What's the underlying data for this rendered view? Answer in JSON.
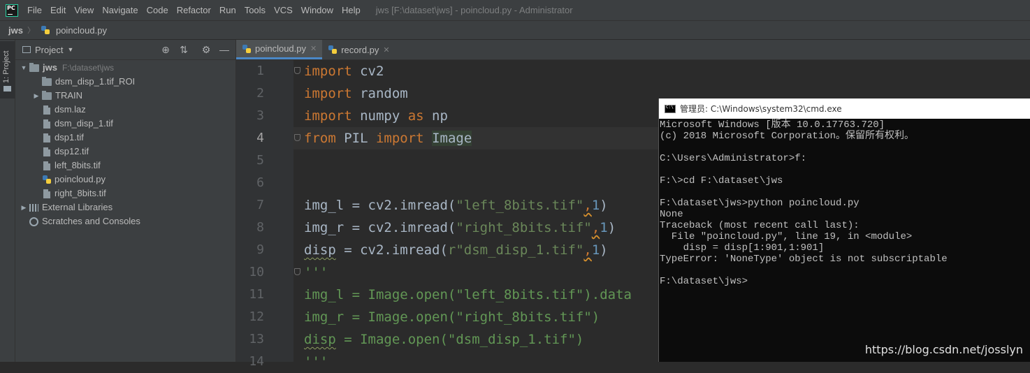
{
  "app": {
    "logo_text": "PC",
    "window_title": "jws [F:\\dataset\\jws] - poincloud.py - Administrator"
  },
  "menu": [
    "File",
    "Edit",
    "View",
    "Navigate",
    "Code",
    "Refactor",
    "Run",
    "Tools",
    "VCS",
    "Window",
    "Help"
  ],
  "breadcrumb": {
    "root": "jws",
    "file": "poincloud.py"
  },
  "toolstrip": {
    "project_tab": "1: Project"
  },
  "project_panel": {
    "title": "Project",
    "tree": [
      {
        "label": "jws",
        "hint": "F:\\dataset\\jws",
        "kind": "folder",
        "expanded": true,
        "depth": 0,
        "bold": true
      },
      {
        "label": "dsm_disp_1.tif_ROI",
        "kind": "folder",
        "depth": 1,
        "expandable": false
      },
      {
        "label": "TRAIN",
        "kind": "folder",
        "depth": 1,
        "expandable": true
      },
      {
        "label": "dsm.laz",
        "kind": "file",
        "depth": 1
      },
      {
        "label": "dsm_disp_1.tif",
        "kind": "file",
        "depth": 1
      },
      {
        "label": "dsp1.tif",
        "kind": "file",
        "depth": 1
      },
      {
        "label": "dsp12.tif",
        "kind": "file",
        "depth": 1
      },
      {
        "label": "left_8bits.tif",
        "kind": "file",
        "depth": 1
      },
      {
        "label": "poincloud.py",
        "kind": "py",
        "depth": 1
      },
      {
        "label": "right_8bits.tif",
        "kind": "file",
        "depth": 1
      },
      {
        "label": "External Libraries",
        "kind": "lib",
        "depth": 0,
        "expandable": true
      },
      {
        "label": "Scratches and Consoles",
        "kind": "scratch",
        "depth": 0
      }
    ]
  },
  "editor": {
    "tabs": [
      {
        "label": "poincloud.py",
        "active": true
      },
      {
        "label": "record.py",
        "active": false
      }
    ],
    "current_line": 4,
    "lines": [
      {
        "n": "1",
        "tokens": [
          [
            "kw",
            "import"
          ],
          [
            "",
            " cv2"
          ]
        ]
      },
      {
        "n": "2",
        "tokens": [
          [
            "kw",
            "import"
          ],
          [
            "",
            " random"
          ]
        ]
      },
      {
        "n": "3",
        "tokens": [
          [
            "kw",
            "import"
          ],
          [
            "",
            " numpy "
          ],
          [
            "kw",
            "as"
          ],
          [
            "",
            " np"
          ]
        ]
      },
      {
        "n": "4",
        "tokens": [
          [
            "kw",
            "from"
          ],
          [
            "",
            " PIL "
          ],
          [
            "kw",
            "import"
          ],
          [
            "",
            " "
          ],
          [
            "hl",
            "Image"
          ]
        ]
      },
      {
        "n": "5",
        "tokens": []
      },
      {
        "n": "6",
        "tokens": []
      },
      {
        "n": "7",
        "tokens": [
          [
            "",
            "img_l = cv2.imread("
          ],
          [
            "str",
            "\"left_8bits.tif\""
          ],
          [
            "warn",
            ","
          ],
          [
            "num",
            "1"
          ],
          [
            "",
            ")"
          ]
        ]
      },
      {
        "n": "8",
        "tokens": [
          [
            "",
            "img_r = cv2.imread("
          ],
          [
            "str",
            "\"right_8bits.tif\""
          ],
          [
            "warn",
            ","
          ],
          [
            "num",
            "1"
          ],
          [
            "",
            ")"
          ]
        ]
      },
      {
        "n": "9",
        "tokens": [
          [
            "sq",
            "disp"
          ],
          [
            "",
            " = cv2.imread("
          ],
          [
            "str",
            "r\"dsm_disp_1.tif\""
          ],
          [
            "warn",
            ","
          ],
          [
            "num",
            "1"
          ],
          [
            "",
            ")"
          ]
        ]
      },
      {
        "n": "10",
        "tokens": [
          [
            "doc",
            "'''"
          ]
        ]
      },
      {
        "n": "11",
        "tokens": [
          [
            "doc",
            "img_l = Image.open(\"left_8bits.tif\").data"
          ]
        ]
      },
      {
        "n": "12",
        "tokens": [
          [
            "doc",
            "img_r = Image.open(\"right_8bits.tif\")"
          ]
        ]
      },
      {
        "n": "13",
        "tokens": [
          [
            "docsq",
            "disp"
          ],
          [
            "doc",
            " = Image.open(\"dsm_disp_1.tif\")"
          ]
        ]
      },
      {
        "n": "14",
        "tokens": [
          [
            "doc",
            "'''"
          ]
        ]
      }
    ]
  },
  "cmd": {
    "title": "管理员: C:\\Windows\\system32\\cmd.exe",
    "lines": [
      "Microsoft Windows [版本 10.0.17763.720]",
      "(c) 2018 Microsoft Corporation。保留所有权利。",
      "",
      "C:\\Users\\Administrator>f:",
      "",
      "F:\\>cd F:\\dataset\\jws",
      "",
      "F:\\dataset\\jws>python poincloud.py",
      "None",
      "Traceback (most recent call last):",
      "  File \"poincloud.py\", line 19, in <module>",
      "    disp = disp[1:901,1:901]",
      "TypeError: 'NoneType' object is not subscriptable",
      "",
      "F:\\dataset\\jws>"
    ]
  },
  "watermark": "https://blog.csdn.net/josslyn",
  "colors": {
    "keyword": "#cc7832",
    "string": "#6a8759",
    "number": "#6897bb",
    "docstring": "#629755",
    "identifier": "#a9b7c6",
    "active_tab_accent": "#4a88c7",
    "console_bg": "#0c0c0c",
    "console_text": "#c0c0c0"
  }
}
